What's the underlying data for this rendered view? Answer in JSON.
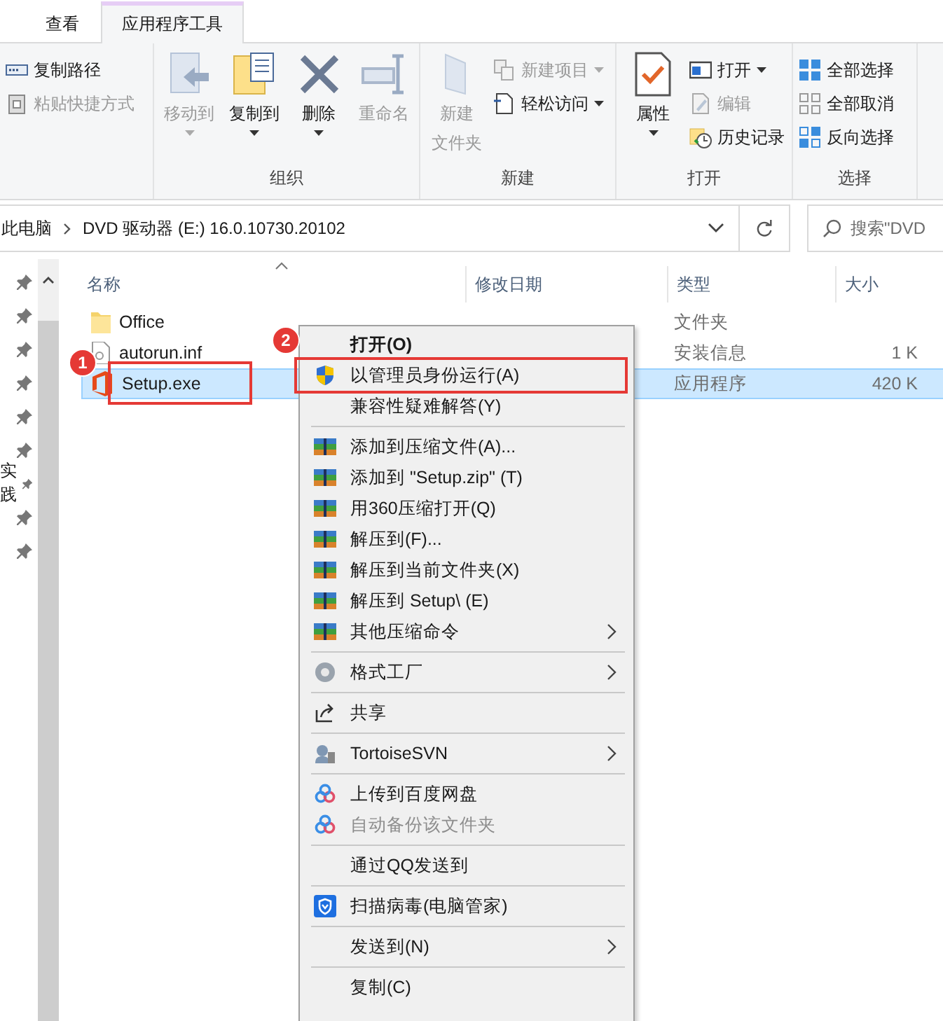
{
  "ribbon": {
    "tabs": [
      {
        "label": "查看",
        "selected": false
      },
      {
        "label": "应用程序工具",
        "selected": true
      }
    ],
    "groups": [
      {
        "items": [
          {
            "kind": "small",
            "label": "复制路径",
            "disabled": false
          },
          {
            "kind": "small",
            "label": "粘贴快捷方式",
            "disabled": true
          }
        ]
      },
      {
        "label": "组织",
        "items": [
          {
            "kind": "large",
            "label": "移动到",
            "disabled": true,
            "dropdown": true
          },
          {
            "kind": "large",
            "label": "复制到",
            "disabled": false,
            "dropdown": true
          },
          {
            "kind": "large",
            "label": "删除",
            "disabled": false,
            "dropdown": true
          },
          {
            "kind": "large",
            "label": "重命名",
            "disabled": true,
            "dropdown": false
          }
        ]
      },
      {
        "label": "新建",
        "items": [
          {
            "kind": "large",
            "label": [
              "新建",
              "文件夹"
            ],
            "disabled": true,
            "dropdown": false
          },
          {
            "kind": "small",
            "label": "新建项目",
            "disabled": true,
            "dropdown": true
          },
          {
            "kind": "small",
            "label": "轻松访问",
            "disabled": false,
            "dropdown": true
          }
        ]
      },
      {
        "label": "打开",
        "items": [
          {
            "kind": "large",
            "label": "属性",
            "disabled": false,
            "dropdown": true
          },
          {
            "kind": "small",
            "label": "打开",
            "disabled": false,
            "dropdown": true
          },
          {
            "kind": "small",
            "label": "编辑",
            "disabled": true,
            "dropdown": false
          },
          {
            "kind": "small",
            "label": "历史记录",
            "disabled": false,
            "dropdown": false
          }
        ]
      },
      {
        "label": "选择",
        "items": [
          {
            "kind": "small",
            "label": "全部选择",
            "disabled": false
          },
          {
            "kind": "small",
            "label": "全部取消",
            "disabled": false
          },
          {
            "kind": "small",
            "label": "反向选择",
            "disabled": false
          }
        ]
      }
    ]
  },
  "address": {
    "crumbs": [
      "此电脑",
      "DVD 驱动器 (E:) 16.0.10730.20102"
    ],
    "search_placeholder": "搜索\"DVD"
  },
  "nav": {
    "items": [
      {
        "pinned": true
      },
      {
        "pinned": true
      },
      {
        "pinned": true
      },
      {
        "pinned": true
      },
      {
        "pinned": true
      },
      {
        "pinned": true
      },
      {
        "pinned": true,
        "label": "实践"
      },
      {
        "pinned": true
      },
      {
        "pinned": true
      }
    ]
  },
  "file_list": {
    "columns": [
      "名称",
      "修改日期",
      "类型",
      "大小"
    ],
    "rows": [
      {
        "name": "Office",
        "type": "文件夹",
        "selected": false
      },
      {
        "name": "autorun.inf",
        "type": "安装信息",
        "size": "1 K",
        "selected": false
      },
      {
        "name": "Setup.exe",
        "type": "应用程序",
        "size": "420 K",
        "selected": true
      }
    ]
  },
  "context_menu": {
    "items": [
      {
        "kind": "command",
        "label": "打开(O)",
        "bold": true
      },
      {
        "kind": "command",
        "label": "以管理员身份运行(A)"
      },
      {
        "kind": "command",
        "label": "兼容性疑难解答(Y)"
      },
      {
        "kind": "separator"
      },
      {
        "kind": "command",
        "label": "添加到压缩文件(A)..."
      },
      {
        "kind": "command",
        "label": "添加到 \"Setup.zip\" (T)"
      },
      {
        "kind": "command",
        "label": "用360压缩打开(Q)"
      },
      {
        "kind": "command",
        "label": "解压到(F)..."
      },
      {
        "kind": "command",
        "label": "解压到当前文件夹(X)"
      },
      {
        "kind": "command",
        "label": "解压到 Setup\\ (E)"
      },
      {
        "kind": "command",
        "label": "其他压缩命令",
        "submenu": true
      },
      {
        "kind": "separator"
      },
      {
        "kind": "command",
        "label": "格式工厂",
        "submenu": true
      },
      {
        "kind": "separator"
      },
      {
        "kind": "command",
        "label": "共享"
      },
      {
        "kind": "separator"
      },
      {
        "kind": "command",
        "label": "TortoiseSVN",
        "submenu": true
      },
      {
        "kind": "separator"
      },
      {
        "kind": "command",
        "label": "上传到百度网盘"
      },
      {
        "kind": "command",
        "label": "自动备份该文件夹",
        "disabled": true
      },
      {
        "kind": "separator"
      },
      {
        "kind": "command",
        "label": "通过QQ发送到"
      },
      {
        "kind": "separator"
      },
      {
        "kind": "command",
        "label": "扫描病毒(电脑管家)"
      },
      {
        "kind": "separator"
      },
      {
        "kind": "command",
        "label": "发送到(N)",
        "submenu": true
      },
      {
        "kind": "separator"
      },
      {
        "kind": "command",
        "label": "复制(C)"
      }
    ]
  },
  "annotations": [
    {
      "label": "1"
    },
    {
      "label": "2"
    }
  ]
}
